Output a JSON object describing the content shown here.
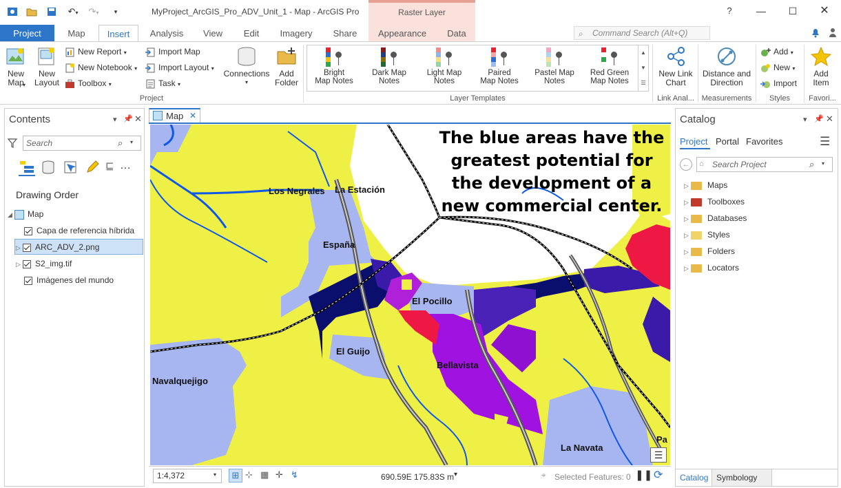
{
  "window": {
    "title": "MyProject_ArcGIS_Pro_ADV_Unit_1 - Map - ArcGIS Pro",
    "context_group": "Raster Layer",
    "help": "?"
  },
  "tabs": [
    "Project",
    "Map",
    "Insert",
    "Analysis",
    "View",
    "Edit",
    "Imagery",
    "Share",
    "Appearance",
    "Data"
  ],
  "command_search": {
    "placeholder": "Command Search (Alt+Q)"
  },
  "ribbon": {
    "new_map": "New\nMap",
    "new_layout": "New\nLayout",
    "new_report": "New Report",
    "new_notebook": "New Notebook",
    "toolbox": "Toolbox",
    "import_map": "Import Map",
    "import_layout": "Import Layout",
    "task": "Task",
    "connections": "Connections",
    "add_folder": "Add\nFolder",
    "group_project": "Project",
    "templates": [
      {
        "label": "Bright\nMap Notes",
        "colors": [
          "#e8232b",
          "#2a6fd6",
          "#f5c400",
          "#2aa84a"
        ]
      },
      {
        "label": "Dark Map\nNotes",
        "colors": [
          "#8a1a1a",
          "#1d3f8a",
          "#8a6d00",
          "#1f6a31"
        ]
      },
      {
        "label": "Light Map\nNotes",
        "colors": [
          "#f28b8b",
          "#8fb3ef",
          "#f7de7a",
          "#8fd6a0"
        ]
      },
      {
        "label": "Paired\nMap Notes",
        "colors": [
          "#e8232b",
          "#f7a6a6",
          "#2a6fd6",
          "#9dbef0"
        ]
      },
      {
        "label": "Pastel Map\nNotes",
        "colors": [
          "#f5a3c7",
          "#a7d8f0",
          "#f9e09a",
          "#b8e6b0"
        ]
      },
      {
        "label": "Red Green\nMap Notes",
        "colors": [
          "#e8232b",
          "#ffffff",
          "#2aa84a",
          "#ffffff"
        ]
      }
    ],
    "group_layer_templates": "Layer Templates",
    "new_link_chart": "New Link\nChart",
    "group_link_analysis": "Link Anal...",
    "distance_direction": "Distance and\nDirection",
    "group_measurements": "Measurements",
    "styles_add": "Add",
    "styles_new": "New",
    "styles_import": "Import",
    "group_styles": "Styles",
    "add_item": "Add\nItem",
    "group_favorites": "Favori..."
  },
  "contents": {
    "title": "Contents",
    "search_placeholder": "Search",
    "drawing_order": "Drawing Order",
    "map_node": "Map",
    "layers": [
      "Capa de referencia híbrida",
      "ARC_ADV_2.png",
      "S2_img.tif",
      "Imágenes del mundo"
    ]
  },
  "map_view": {
    "tab_label": "Map",
    "annotation": "The blue areas have the greatest potential for the development of a new commercial center.",
    "place_labels": [
      "Los Negrales",
      "La Estación",
      "España",
      "El Pocillo",
      "El Guijo",
      "Bellavista",
      "Navalquejigo",
      "La Navata",
      "Pa"
    ],
    "scale": "1:4,372",
    "coordinates": "690.59E 175.83S m",
    "selected_features": "Selected Features: 0"
  },
  "catalog": {
    "title": "Catalog",
    "tabs": [
      "Project",
      "Portal",
      "Favorites"
    ],
    "search_placeholder": "Search Project",
    "items": [
      "Maps",
      "Toolboxes",
      "Databases",
      "Styles",
      "Folders",
      "Locators"
    ],
    "bottom_tabs": [
      "Catalog",
      "Symbology"
    ]
  }
}
